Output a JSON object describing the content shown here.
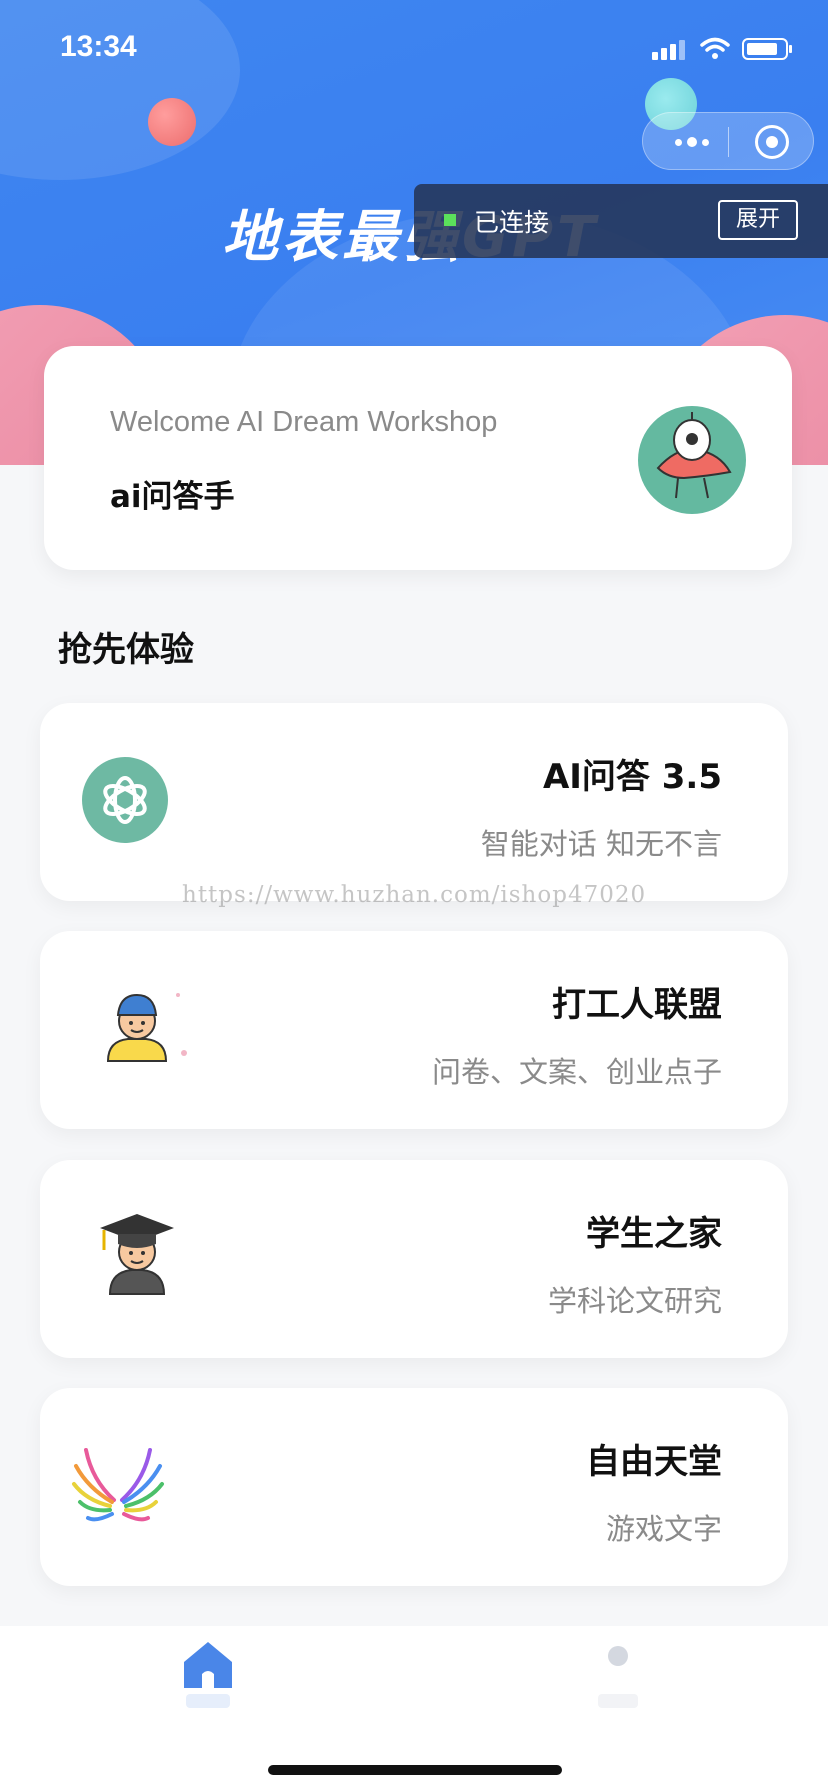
{
  "status_bar": {
    "time": "13:34"
  },
  "header": {
    "app_title": "地表最强GPT",
    "connection": {
      "status": "已连接",
      "expand_label": "展开"
    }
  },
  "welcome": {
    "subtitle": "Welcome AI Dream Workshop",
    "title": "ai问答手"
  },
  "section": {
    "title": "抢先体验"
  },
  "features": [
    {
      "title": "AI问答 3.5",
      "desc": "智能对话 知无不言",
      "icon": "openai-logo-icon"
    },
    {
      "title": "打工人联盟",
      "desc": "问卷、文案、创业点子",
      "icon": "worker-avatar-icon"
    },
    {
      "title": "学生之家",
      "desc": "学科论文研究",
      "icon": "graduate-avatar-icon"
    },
    {
      "title": "自由天堂",
      "desc": "游戏文字",
      "icon": "rainbow-wings-icon"
    }
  ],
  "watermark": "https://www.huzhan.com/ishop47020",
  "tabbar": {
    "items": [
      {
        "icon": "home-icon"
      },
      {
        "icon": "user-icon"
      }
    ]
  },
  "colors": {
    "primary": "#3f86f0",
    "accent_pink": "#ec8aa3",
    "teal": "#64b9a0"
  }
}
